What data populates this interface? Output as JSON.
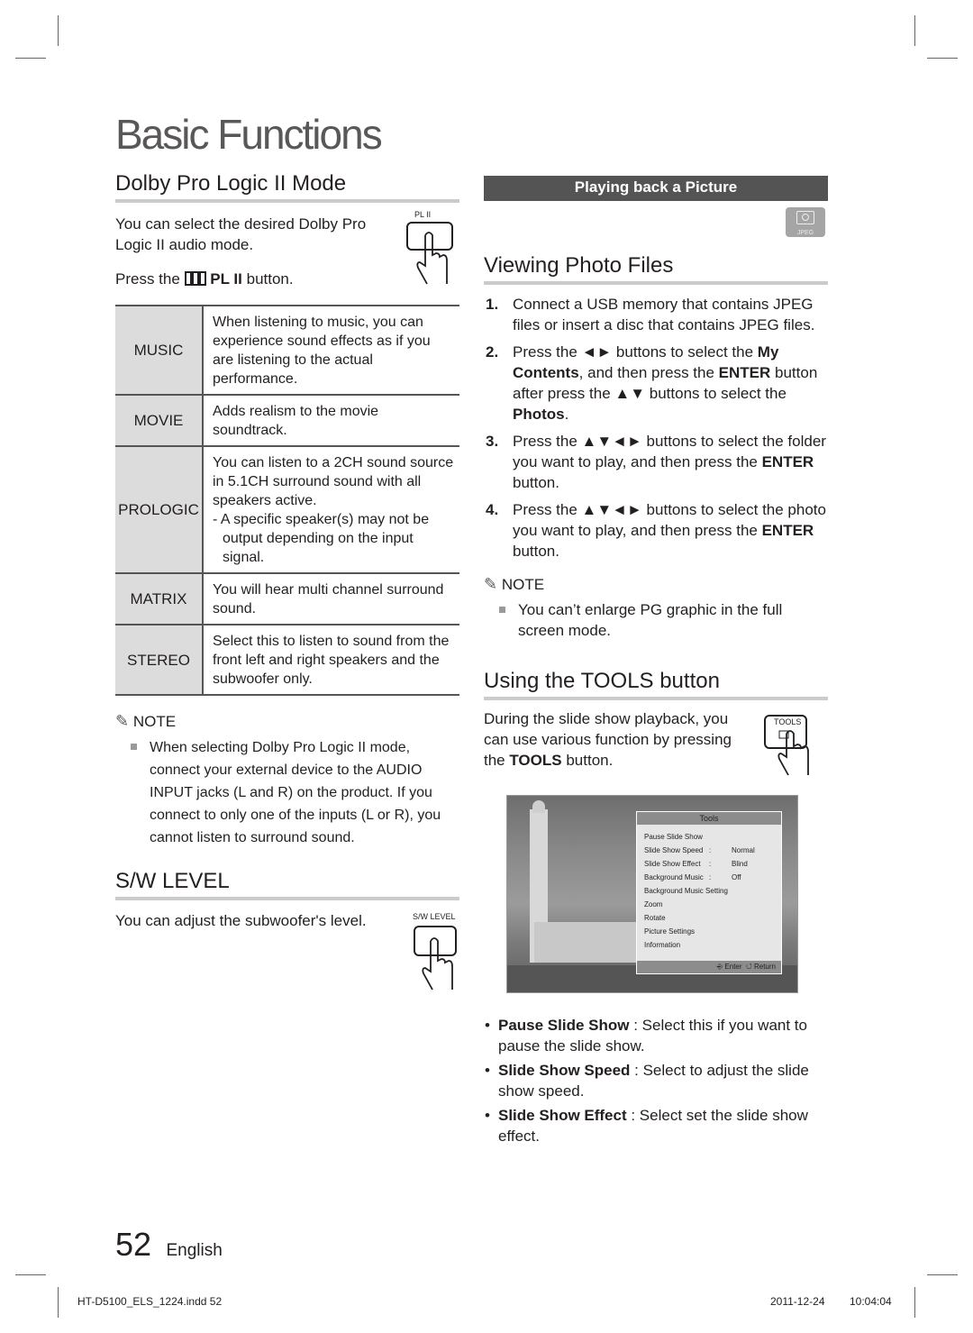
{
  "page": {
    "title": "Basic Functions",
    "page_number": "52",
    "language": "English",
    "footer_file": "HT-D5100_ELS_1224.indd   52",
    "footer_date": "2011-12-24",
    "footer_time": "10:04:04"
  },
  "dolby": {
    "heading": "Dolby Pro Logic II Mode",
    "intro": "You can select the desired Dolby Pro Logic II audio mode.",
    "press_prefix": "Press the",
    "press_button": "PL II",
    "press_suffix": "button.",
    "remote_label": "PL II",
    "modes": [
      {
        "key": "MUSIC",
        "desc": "When listening to music, you can experience sound effects as if you are listening to the actual performance."
      },
      {
        "key": "MOVIE",
        "desc": "Adds realism to the movie soundtrack."
      },
      {
        "key": "PROLOGIC",
        "desc": "You can listen to a 2CH sound source in 5.1CH surround sound with all speakers active.",
        "sub": "- A specific speaker(s) may not be output depending on the input signal."
      },
      {
        "key": "MATRIX",
        "desc": "You will hear multi channel surround sound."
      },
      {
        "key": "STEREO",
        "desc": "Select this to listen to sound from the front left and right speakers and the subwoofer only."
      }
    ],
    "note_title": "NOTE",
    "note": "When selecting Dolby Pro Logic II mode, connect your external device to the AUDIO INPUT jacks (L and R) on the product. If you connect to only one of the inputs (L or R), you cannot listen to surround sound."
  },
  "sw": {
    "heading": "S/W LEVEL",
    "text": "You can adjust the subwoofer's level.",
    "remote_label": "S/W LEVEL"
  },
  "picture": {
    "banner": "Playing back a Picture",
    "badge": "JPEG",
    "heading": "Viewing Photo Files",
    "steps": [
      {
        "n": "1.",
        "parts": [
          [
            "",
            "Connect a USB memory that contains JPEG files or insert a disc that contains JPEG files."
          ]
        ]
      },
      {
        "n": "2.",
        "parts": [
          [
            "",
            "Press the ◄► buttons to select the "
          ],
          [
            "b",
            "My Contents"
          ],
          [
            "",
            ", and then press the "
          ],
          [
            "b",
            "ENTER"
          ],
          [
            "",
            " button after press the ▲▼ buttons to select the "
          ],
          [
            "b",
            "Photos"
          ],
          [
            "",
            "."
          ]
        ]
      },
      {
        "n": "3.",
        "parts": [
          [
            "",
            "Press the ▲▼◄► buttons to select the folder you want to play, and then press the "
          ],
          [
            "b",
            "ENTER"
          ],
          [
            "",
            " button."
          ]
        ]
      },
      {
        "n": "4.",
        "parts": [
          [
            "",
            "Press the ▲▼◄► buttons to select the photo you want to play, and then press the "
          ],
          [
            "b",
            "ENTER"
          ],
          [
            "",
            " button."
          ]
        ]
      }
    ],
    "note_title": "NOTE",
    "note": "You can’t enlarge PG graphic in the full screen mode."
  },
  "tools": {
    "heading": "Using the TOOLS button",
    "intro_a": "During the slide show playback, you can use various function by pressing the ",
    "intro_b": "TOOLS",
    "intro_c": " button.",
    "remote_label": "TOOLS",
    "menu": {
      "title": "Tools",
      "items": [
        {
          "label": "Pause Slide Show"
        },
        {
          "label": "Slide Show Speed",
          "value": "Normal"
        },
        {
          "label": "Slide Show Effect",
          "value": "Blind"
        },
        {
          "label": "Background Music",
          "value": "Off"
        },
        {
          "label": "Background Music Setting"
        },
        {
          "label": "Zoom"
        },
        {
          "label": "Rotate"
        },
        {
          "label": "Picture Settings"
        },
        {
          "label": "Information"
        }
      ],
      "footer_enter": "Enter",
      "footer_return": "Return"
    },
    "bullets": [
      {
        "term": "Pause Slide Show",
        "desc": " : Select this if you want to pause the slide show."
      },
      {
        "term": "Slide Show Speed",
        "desc": " : Select to adjust the slide show speed."
      },
      {
        "term": "Slide Show Effect",
        "desc": " : Select set the slide show effect."
      }
    ]
  }
}
